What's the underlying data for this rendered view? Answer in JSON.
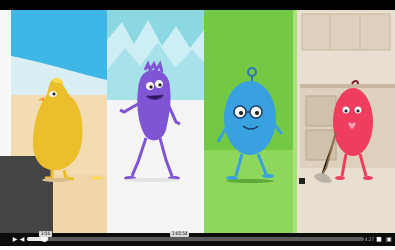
{
  "player": {
    "playback_fraction": 0.05,
    "hover_tooltip": "3:56",
    "chapter_tooltip": "1:05:54",
    "time_readout": "4:27",
    "controls": {
      "play_icon": "play-icon",
      "volume_icon": "volume-icon",
      "settings_icon": "settings-icon",
      "fullscreen_icon": "fullscreen-icon"
    }
  },
  "scene": {
    "panels": [
      {
        "name": "beach",
        "colors": [
          "#3fb7e6",
          "#f3dcb1",
          "#f7ead1"
        ]
      },
      {
        "name": "mountains",
        "colors": [
          "#8bd8e3",
          "#f4f4f4"
        ]
      },
      {
        "name": "park",
        "colors": [
          "#74c944",
          "#a9e27a"
        ]
      },
      {
        "name": "kitchen",
        "colors": [
          "#e9dfd0",
          "#c7b79f"
        ]
      }
    ],
    "characters": [
      {
        "name": "yellow-character",
        "color": "#ebbf2c"
      },
      {
        "name": "purple-character",
        "color": "#7f55d3"
      },
      {
        "name": "blue-character",
        "color": "#3aa1e0"
      },
      {
        "name": "pink-character",
        "color": "#ef3d5e"
      }
    ]
  }
}
